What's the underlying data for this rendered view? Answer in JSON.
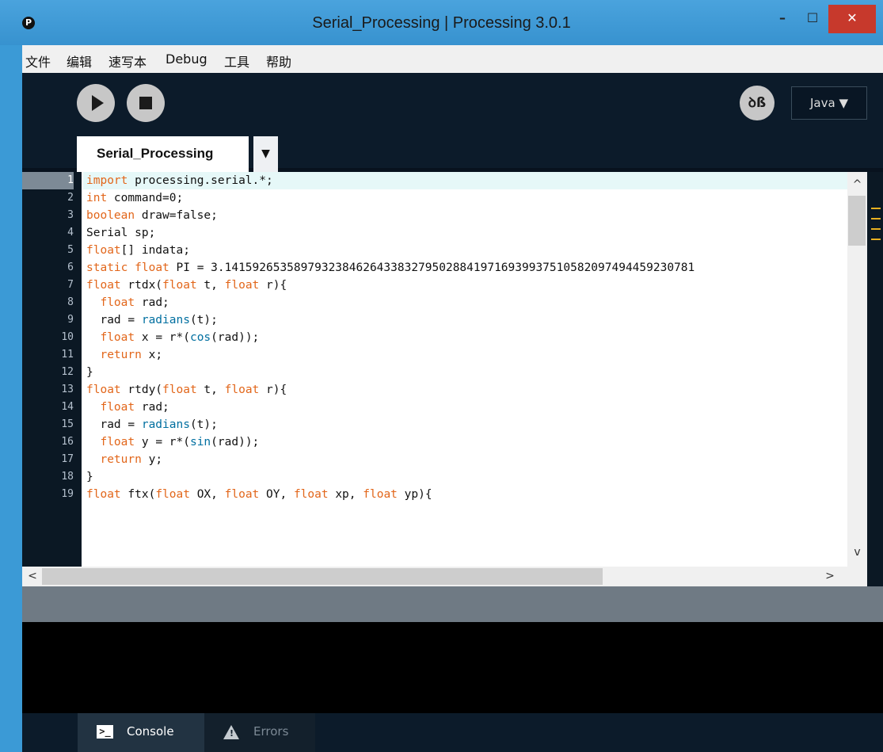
{
  "window": {
    "title": "Serial_Processing | Processing 3.0.1",
    "app_icon_glyph": "P"
  },
  "window_controls": {
    "minimize": "–",
    "maximize": "☐",
    "close": "✕"
  },
  "menubar": {
    "items": [
      "文件",
      "编辑",
      "速写本",
      "Debug",
      "工具",
      "帮助"
    ]
  },
  "toolbar": {
    "debug_glyph": "ꝺß",
    "mode_label": "Java ▼"
  },
  "tabs": {
    "active": "Serial_Processing",
    "menu_glyph": "▼"
  },
  "editor": {
    "active_line": 1,
    "line_numbers": [
      "1",
      "2",
      "3",
      "4",
      "5",
      "6",
      "7",
      "8",
      "9",
      "10",
      "11",
      "12",
      "13",
      "14",
      "15",
      "16",
      "17",
      "18",
      "19"
    ],
    "lines": [
      "import processing.serial.*;",
      "int command=0;",
      "boolean draw=false;",
      "Serial sp;",
      "float[] indata;",
      "static float PI = 3.14159265358979323846264338327950288419716939937510582097494459230781",
      "float rtdx(float t, float r){",
      "  float rad;",
      "  rad = radians(t);",
      "  float x = r*(cos(rad));",
      "  return x;",
      "}",
      "float rtdy(float t, float r){",
      "  float rad;",
      "  rad = radians(t);",
      "  float y = r*(sin(rad));",
      "  return y;",
      "}",
      "float ftx(float OX, float OY, float xp, float yp){"
    ],
    "scroll": {
      "up": "^",
      "down": "v",
      "left": "<",
      "right": ">"
    }
  },
  "console_tabs": {
    "console_label": "Console",
    "errors_label": "Errors"
  },
  "icons": [
    "app-icon",
    "run-icon",
    "stop-icon",
    "debug-icon",
    "terminal-icon",
    "warning-icon"
  ],
  "colors": {
    "keyword": "#e2661a",
    "function": "#006fa0",
    "background": "#08121e",
    "title_bar": "#3b9ad6"
  }
}
